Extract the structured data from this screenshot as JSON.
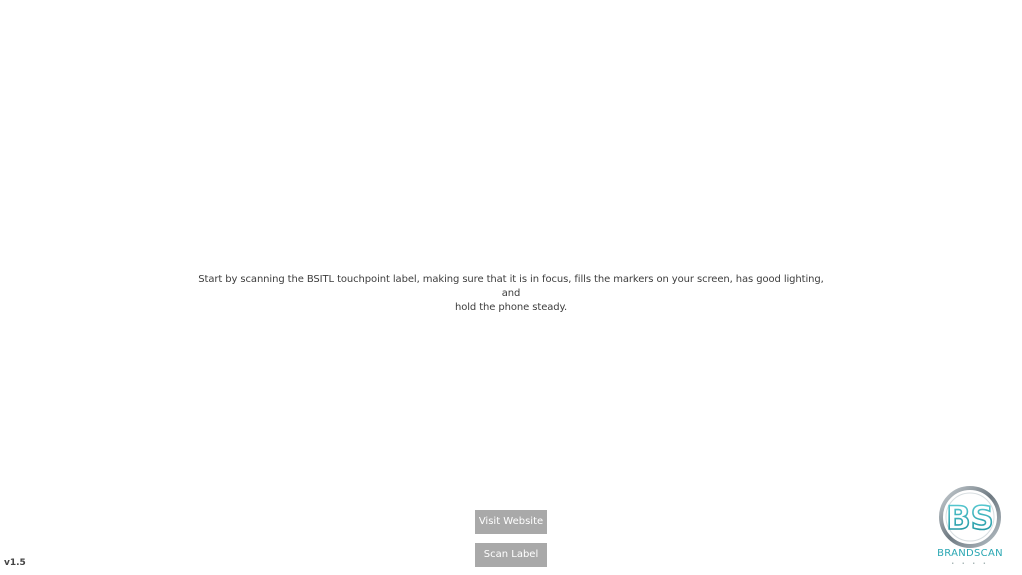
{
  "instructions": {
    "line1": "Start by scanning the BSITL touchpoint label, making sure that it is in focus, fills the markers on your screen, has good lighting, and",
    "line2": "hold the phone steady."
  },
  "buttons": {
    "visit_label": "Visit Website",
    "scan_label": "Scan Label"
  },
  "version": "v1.5",
  "logo": {
    "monogram": "BS",
    "caption": "BRANDSCAN",
    "accent_color": "#2aa7b3",
    "metal_color": "#8a949c"
  },
  "colors": {
    "background": "#ffffff",
    "button_bg": "#a9a9a9",
    "button_text": "#ffffff",
    "text": "#3d3d3d"
  }
}
